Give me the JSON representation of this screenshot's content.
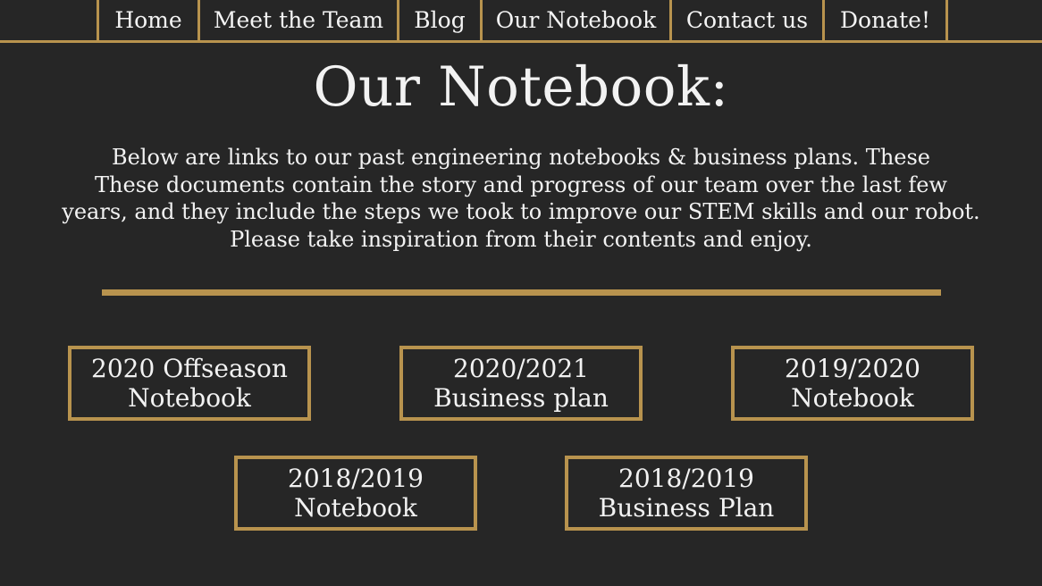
{
  "nav": {
    "items": [
      {
        "label": "Home"
      },
      {
        "label": "Meet the Team"
      },
      {
        "label": "Blog"
      },
      {
        "label": "Our Notebook"
      },
      {
        "label": "Contact us"
      },
      {
        "label": "Donate!"
      }
    ]
  },
  "page": {
    "title": "Our Notebook:",
    "intro_lines": [
      "Below are links to our past engineering notebooks & business plans. These",
      "These documents contain the story and progress of our team over the last few",
      "years, and they include the steps we took to improve our STEM skills and our robot.",
      "Please take inspiration from their contents and enjoy."
    ]
  },
  "documents": [
    {
      "line1": "2020 Offseason",
      "line2": "Notebook"
    },
    {
      "line1": "2020/2021",
      "line2": "Business plan"
    },
    {
      "line1": "2019/2020",
      "line2": "Notebook"
    },
    {
      "line1": "2018/2019",
      "line2": "Notebook"
    },
    {
      "line1": "2018/2019",
      "line2": "Business Plan"
    }
  ],
  "colors": {
    "background": "#262626",
    "accent": "#b8934e",
    "text": "#f2f2f2"
  }
}
